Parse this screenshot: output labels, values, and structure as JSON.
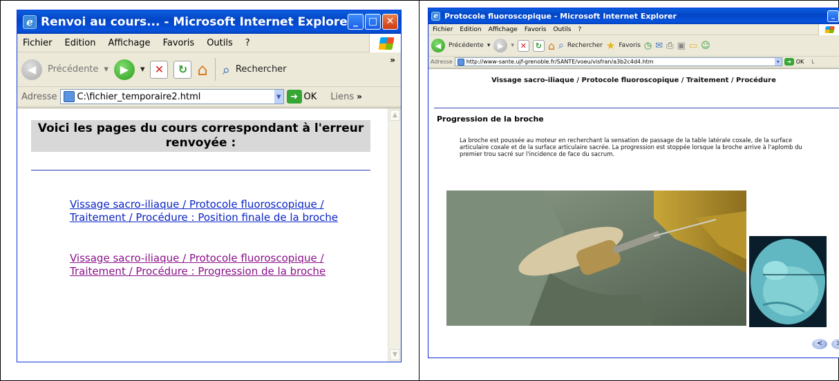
{
  "left_window": {
    "title": "Renvoi au cours... - Microsoft Internet Explorer",
    "menu": [
      "Fichier",
      "Edition",
      "Affichage",
      "Favoris",
      "Outils",
      "?"
    ],
    "toolbar": {
      "back": "Précédente",
      "search": "Rechercher",
      "more": "»"
    },
    "address": {
      "label": "Adresse",
      "value": "C:\\fichier_temporaire2.html",
      "go": "OK",
      "links": "Liens",
      "more": "»"
    },
    "page": {
      "heading": "Voici les pages du cours correspondant à l'erreur renvoyée :",
      "links": [
        {
          "text": "Vissage sacro-iliaque / Protocole fluoroscopique / Traitement / Procédure : Position finale de la broche",
          "state": "unvisited"
        },
        {
          "text": "Vissage sacro-iliaque / Protocole fluoroscopique / Traitement / Procédure : Progression de la broche",
          "state": "visited"
        }
      ]
    }
  },
  "right_window": {
    "title": "Protocole fluoroscopique - Microsoft Internet Explorer",
    "menu": [
      "Fichier",
      "Edition",
      "Affichage",
      "Favoris",
      "Outils",
      "?"
    ],
    "toolbar": {
      "back": "Précédente",
      "search": "Rechercher",
      "favorites": "Favoris"
    },
    "address": {
      "label": "Adresse",
      "value": "http://www-sante.ujf-grenoble.fr/SANTE/voeu/visfran/a3b2c4d4.htm",
      "go": "OK",
      "links": "L"
    },
    "page": {
      "breadcrumb": "Vissage sacro-iliaque / Protocole fluoroscopique / Traitement / Procédure",
      "subtitle": "Progression de la broche",
      "paragraph": "La broche est poussée au moteur en recherchant la sensation de passage de la table latérale coxale, de la surface articulaire coxale et de la surface articulaire sacrée. La progression est stoppée lorsque la broche arrive à l'aplomb du premier trou sacré sur l'incidence de face du sacrum.",
      "nav": {
        "prev": "<",
        "next": ">"
      }
    }
  },
  "colors": {
    "titlebar": "#0853dd",
    "link": "#0a24c6",
    "visited": "#8a0f8a",
    "rule": "#2b3fb1"
  }
}
